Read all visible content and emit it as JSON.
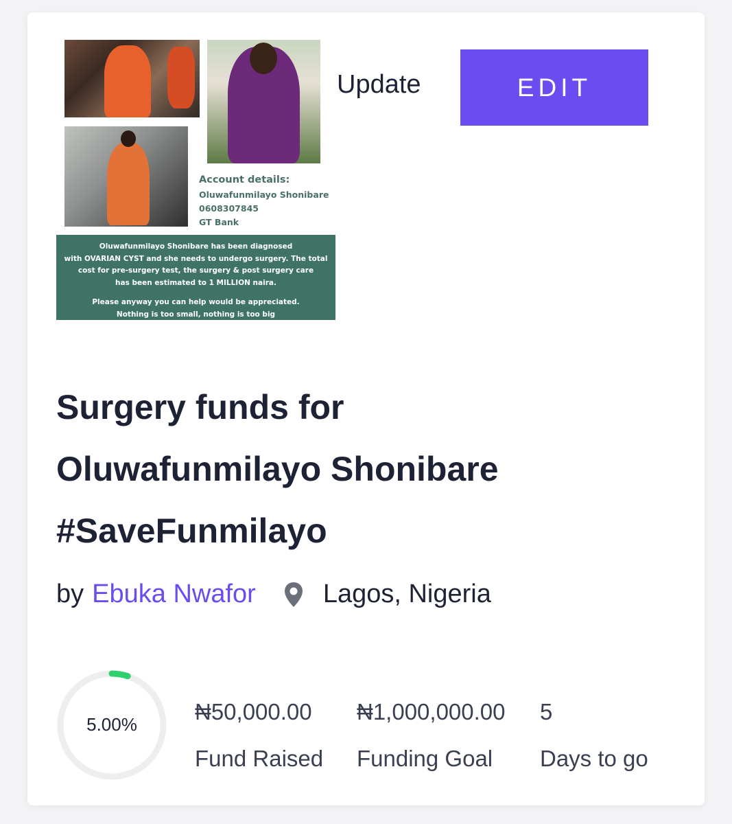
{
  "campaign": {
    "update_label": "Update",
    "edit_label": "EDIT",
    "title_lines": [
      "Surgery funds for",
      "Oluwafunmilayo Shonibare",
      "#SaveFunmilayo"
    ],
    "by_prefix": "by",
    "author": "Ebuka Nwafor",
    "location": "Lagos, Nigeria",
    "location_icon": "map-pin-icon"
  },
  "poster": {
    "account_heading": "Account details:",
    "account_name": "Oluwafunmilayo Shonibare",
    "account_number": "0608307845",
    "bank": "GT Bank",
    "banner_line1": "Oluwafunmilayo Shonibare has been diagnosed",
    "banner_line2": "with OVARIAN CYST and she needs to undergo surgery. The total",
    "banner_line3": "cost for pre-surgery test, the surgery & post surgery care",
    "banner_line4": "has been estimated to 1 MILLION naira.",
    "banner_line5": "Please anyway you can help would be appreciated.",
    "banner_line6": "Nothing is too small, nothing is too big"
  },
  "stats": {
    "progress_label": "5.00%",
    "progress_fraction": 0.05,
    "raised_value": "₦50,000.00",
    "raised_label": "Fund Raised",
    "goal_value": "₦1,000,000.00",
    "goal_label": "Funding Goal",
    "days_value": "5",
    "days_label": "Days to go"
  },
  "colors": {
    "accent": "#6a4cf0",
    "progress": "#2ecf6f",
    "banner": "#3e7366"
  }
}
